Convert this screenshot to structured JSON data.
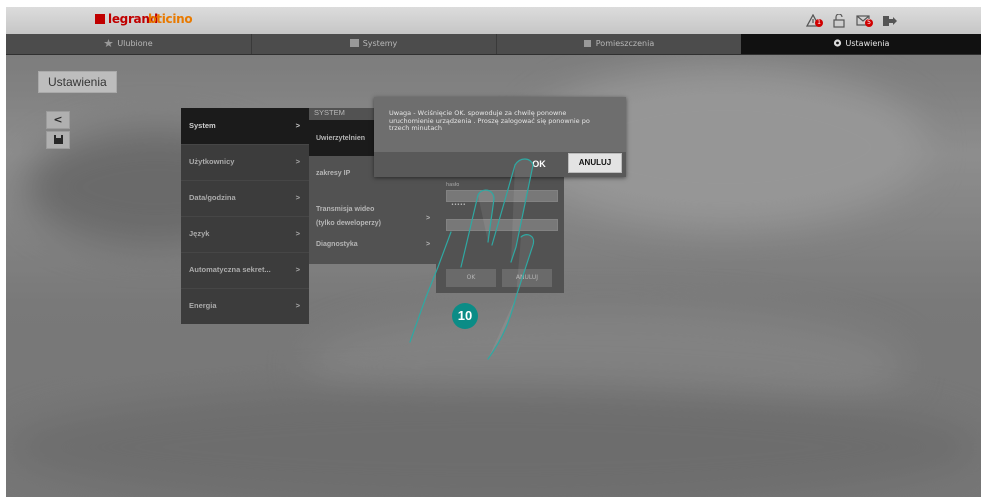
{
  "brand": {
    "legrand": "legrand",
    "bticino": "bticino"
  },
  "topbar": {
    "icons": [
      {
        "name": "alarm-icon",
        "badge": "1"
      },
      {
        "name": "lock-icon",
        "badge": ""
      },
      {
        "name": "envelope-icon",
        "badge": "5"
      },
      {
        "name": "logout-icon",
        "badge": ""
      }
    ],
    "badge_color": "#d00000"
  },
  "nav": {
    "tabs": [
      {
        "label": "Ulubione",
        "icon": "star-icon"
      },
      {
        "label": "Systemy",
        "icon": "systems-icon"
      },
      {
        "label": "Pomieszczenia",
        "icon": "rooms-icon"
      },
      {
        "label": "Ustawienia",
        "icon": "gear-icon",
        "active": true
      }
    ]
  },
  "page": {
    "title": "Ustawienia"
  },
  "sidebar": {
    "back_glyph": "<",
    "save_icon": "floppy-icon"
  },
  "menu": {
    "items": [
      {
        "label": "System",
        "arrow": ">"
      },
      {
        "label": "Użytkownicy",
        "arrow": ">"
      },
      {
        "label": "Data/godzina",
        "arrow": ">"
      },
      {
        "label": "Język",
        "arrow": ">"
      },
      {
        "label": "Automatyczna sekret...",
        "arrow": ">"
      },
      {
        "label": "Energia",
        "arrow": ">"
      }
    ]
  },
  "submenu": {
    "heading": "SYSTEM",
    "items": [
      {
        "label": "Uwierzytelnien"
      },
      {
        "label": "zakresy IP"
      },
      {
        "label": "Transmisja wideo"
      },
      {
        "label": "(tylko deweloperzy)",
        "arrow": ">"
      },
      {
        "label": "Diagnostyka",
        "arrow": ">"
      }
    ]
  },
  "form": {
    "label1": "hasło",
    "value1": "•••••",
    "label2": "",
    "ok_label": "OK",
    "cancel_label": "ANULUJ"
  },
  "dialog": {
    "message": "Uwaga - Wciśnięcie OK. spowoduje za chwilę ponowne uruchomienie urządzenia . Proszę zalogować się ponownie po trzech minutach",
    "ok_label": "OK",
    "cancel_label": "ANULUJ"
  },
  "step": {
    "number": "10",
    "color": "#0b8c86"
  }
}
